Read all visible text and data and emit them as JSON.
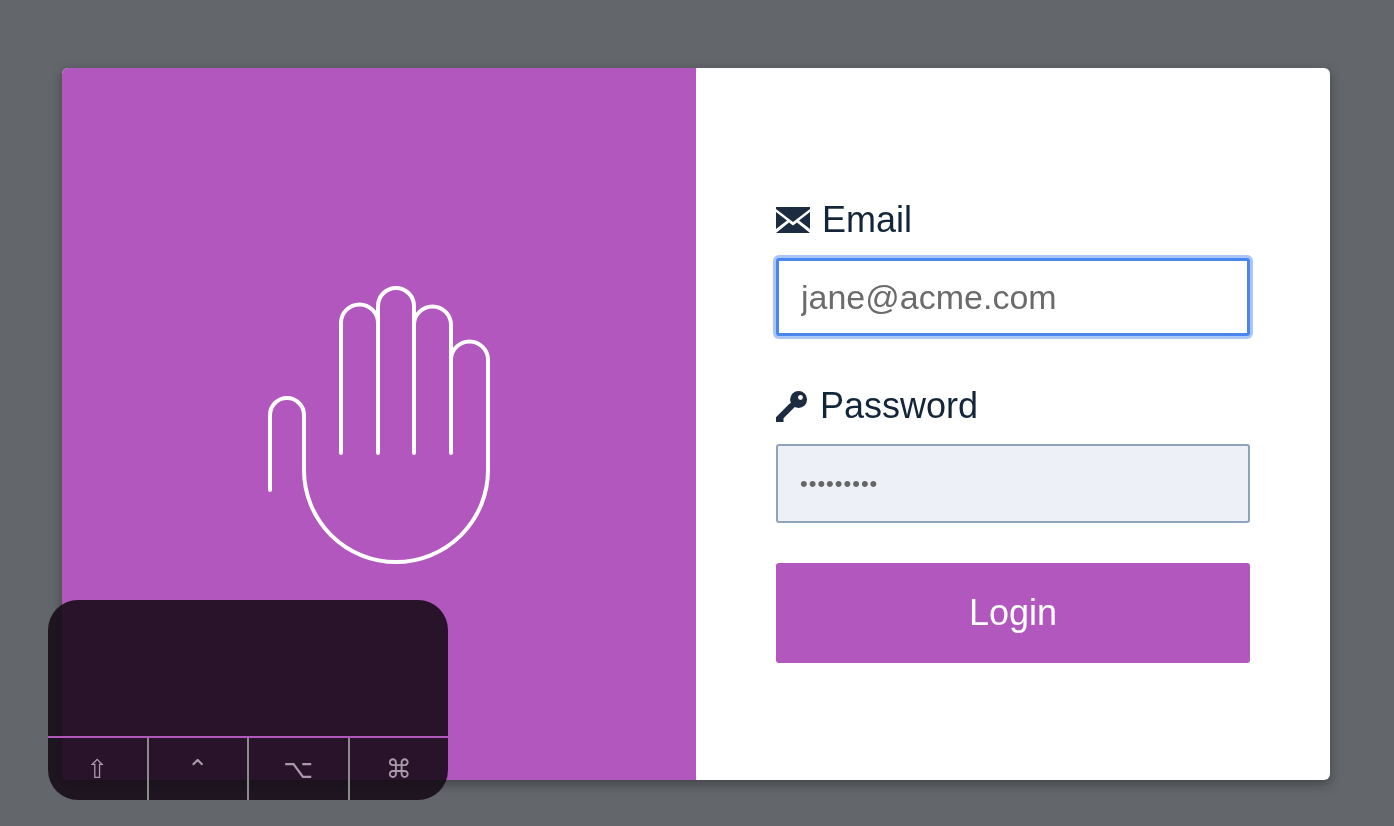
{
  "email": {
    "label": "Email",
    "placeholder": "jane@acme.com",
    "focused": true
  },
  "password": {
    "label": "Password",
    "value": "•••••••••"
  },
  "login_button": {
    "label": "Login"
  },
  "keyboard_overlay": {
    "keys": [
      "⇧",
      "⌃",
      "⌥",
      "⌘"
    ]
  }
}
